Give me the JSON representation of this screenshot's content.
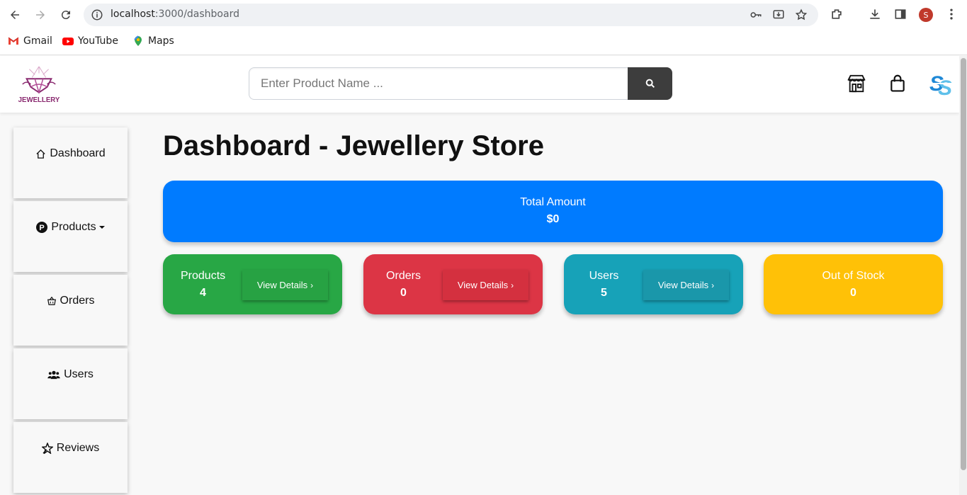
{
  "browser": {
    "url_host": "localhost",
    "url_path": ":3000/dashboard",
    "profile_initial": "S",
    "bookmarks": [
      {
        "label": "Gmail",
        "icon": "gmail-icon"
      },
      {
        "label": "YouTube",
        "icon": "youtube-icon"
      },
      {
        "label": "Maps",
        "icon": "maps-icon"
      }
    ]
  },
  "header": {
    "logo_text": "JEWELLERY",
    "search_placeholder": "Enter Product Name ...",
    "search_icon": "search-icon",
    "store_icon": "store-icon",
    "cart_icon": "shopping-bag-icon",
    "brand_logo": "ss-logo"
  },
  "sidebar": {
    "items": [
      {
        "label": "Dashboard",
        "icon": "home-icon"
      },
      {
        "label": "Products",
        "icon": "p-circle-icon",
        "dropdown": true
      },
      {
        "label": "Orders",
        "icon": "basket-icon"
      },
      {
        "label": "Users",
        "icon": "users-icon"
      },
      {
        "label": "Reviews",
        "icon": "star-icon"
      }
    ]
  },
  "main": {
    "title": "Dashboard - Jewellery Store",
    "total": {
      "label": "Total Amount",
      "value": "$0",
      "color": "#007bff"
    },
    "cards": [
      {
        "label": "Products",
        "value": "4",
        "button": "View Details",
        "color": "#28a745",
        "button_color": "#27a243"
      },
      {
        "label": "Orders",
        "value": "0",
        "button": "View Details",
        "color": "#dc3545",
        "button_color": "#d4303f"
      },
      {
        "label": "Users",
        "value": "5",
        "button": "View Details",
        "color": "#17a2b8",
        "button_color": "#1a97aa"
      },
      {
        "label": "Out of Stock",
        "value": "0",
        "color": "#ffc107"
      }
    ]
  }
}
